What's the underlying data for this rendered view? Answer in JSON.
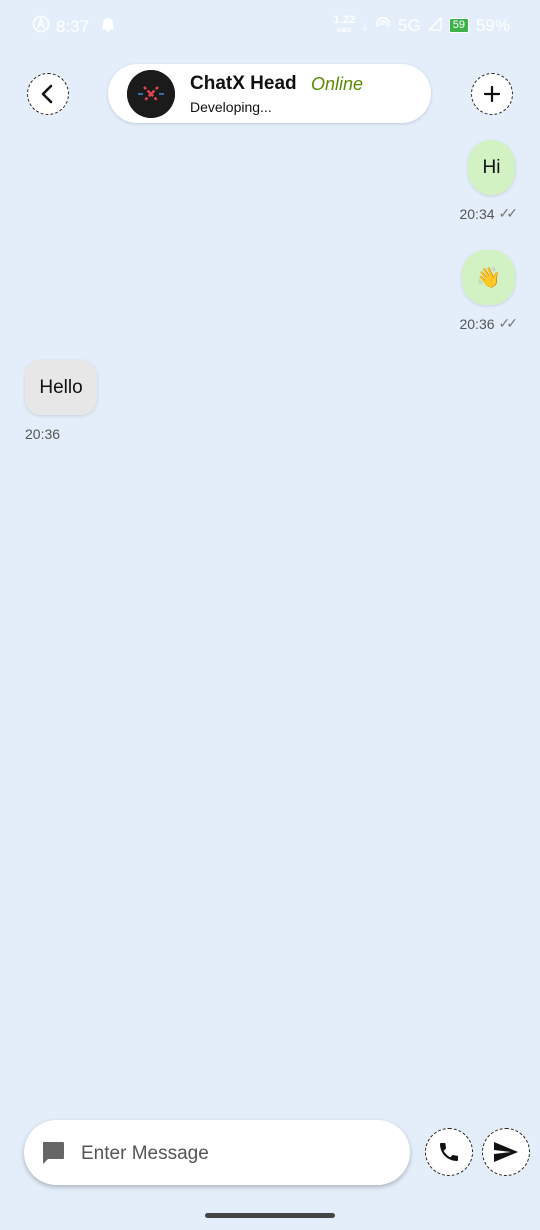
{
  "status_bar": {
    "time": "8:37",
    "speed_value": "1.22",
    "speed_unit": "KB/S",
    "network": "5G",
    "battery_level": "59",
    "battery_percent": "59%"
  },
  "header": {
    "contact_name": "ChatX Head",
    "presence": "Online",
    "status_text": "Developing..."
  },
  "messages": [
    {
      "direction": "out",
      "text": "Hi",
      "time": "20:34",
      "ticks": "✓✓"
    },
    {
      "direction": "out",
      "text": "👋",
      "time": "20:36",
      "ticks": "✓✓"
    },
    {
      "direction": "in",
      "text": "Hello",
      "time": "20:36"
    }
  ],
  "composer": {
    "placeholder": "Enter Message"
  },
  "colors": {
    "background": "#e3eefa",
    "outgoing_bubble": "#d3f2c4",
    "incoming_bubble": "#e7e7e7",
    "online": "#5a8a00"
  }
}
